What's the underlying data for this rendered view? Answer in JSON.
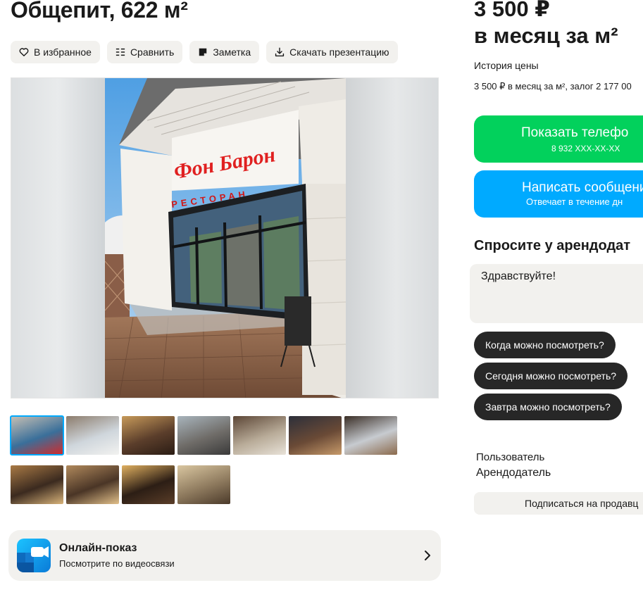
{
  "listing": {
    "title": "Общепит, 622 м²"
  },
  "actions": [
    {
      "label": "В избранное",
      "icon": "heart-icon"
    },
    {
      "label": "Сравнить",
      "icon": "compare-icon"
    },
    {
      "label": "Заметка",
      "icon": "note-icon"
    },
    {
      "label": "Скачать презентацию",
      "icon": "download-icon"
    }
  ],
  "gallery": {
    "sign_text": "Фон Барон",
    "sign_subtext": "РЕСТОРАН",
    "thumb_count_row1": 7,
    "thumb_count_row2": 4
  },
  "online_view": {
    "title": "Онлайн-показ",
    "subtitle": "Посмотрите по видеосвязи"
  },
  "price": {
    "line1": "3 500 ₽",
    "line2": "в месяц за м²",
    "history_label": "История цены",
    "history_detail": "3 500 ₽ в месяц за м², залог 2 177 00"
  },
  "contact": {
    "phone_label": "Показать телефо",
    "phone_masked": "8 932 XXX-XX-XX",
    "message_label": "Написать сообщени",
    "message_sub": "Отвечает в течение дн"
  },
  "ask": {
    "heading": "Спросите у арендодат",
    "textarea_value": "Здравствуйте!",
    "chips": [
      "Когда можно посмотреть?",
      "Сегодня можно посмотреть?",
      "Завтра можно посмотреть?"
    ]
  },
  "seller": {
    "type": "Пользователь",
    "role": "Арендодатель",
    "subscribe_label": "Подписаться на продавц"
  },
  "colors": {
    "accent_green": "#02d15c",
    "accent_blue": "#00aaff",
    "chip_bg": "#272727",
    "button_bg": "#f2f1ee"
  }
}
